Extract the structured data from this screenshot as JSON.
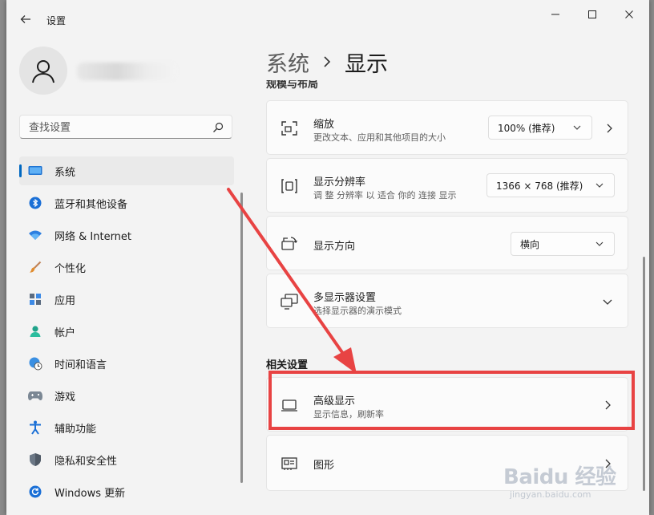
{
  "window": {
    "title": "设置"
  },
  "sidebar": {
    "search_placeholder": "查找设置",
    "items": [
      {
        "label": "系统",
        "icon": "monitor-icon",
        "active": true
      },
      {
        "label": "蓝牙和其他设备",
        "icon": "bluetooth-icon"
      },
      {
        "label": "网络 & Internet",
        "icon": "wifi-icon"
      },
      {
        "label": "个性化",
        "icon": "brush-icon"
      },
      {
        "label": "应用",
        "icon": "apps-icon"
      },
      {
        "label": "帐户",
        "icon": "user-icon"
      },
      {
        "label": "时间和语言",
        "icon": "globe-clock-icon"
      },
      {
        "label": "游戏",
        "icon": "gamepad-icon"
      },
      {
        "label": "辅助功能",
        "icon": "accessibility-icon"
      },
      {
        "label": "隐私和安全性",
        "icon": "shield-icon"
      },
      {
        "label": "Windows 更新",
        "icon": "update-icon"
      }
    ]
  },
  "main": {
    "breadcrumb_parent": "系统",
    "breadcrumb_current": "显示",
    "section_cut_label": "规模与布局",
    "cards": {
      "scale": {
        "title": "缩放",
        "subtitle": "更改文本、应用和其他项目的大小",
        "value": "100% (推荐)"
      },
      "resolution": {
        "title": "显示分辨率",
        "subtitle": "调 整 分辨率 以 适合 你的 连接 显示",
        "value": "1366 × 768 (推荐)"
      },
      "orientation": {
        "title": "显示方向",
        "value": "横向"
      },
      "multi": {
        "title": "多显示器设置",
        "subtitle": "选择显示器的演示模式"
      }
    },
    "related_label": "相关设置",
    "related": {
      "advanced": {
        "title": "高级显示",
        "subtitle": "显示信息，刷新率"
      },
      "graphics": {
        "title": "图形"
      }
    }
  },
  "watermark": {
    "brand": "Baidu 经验",
    "url": "jingyan.baidu.com"
  },
  "colors": {
    "accent": "#0067c0",
    "annotation_red": "#e84343"
  }
}
